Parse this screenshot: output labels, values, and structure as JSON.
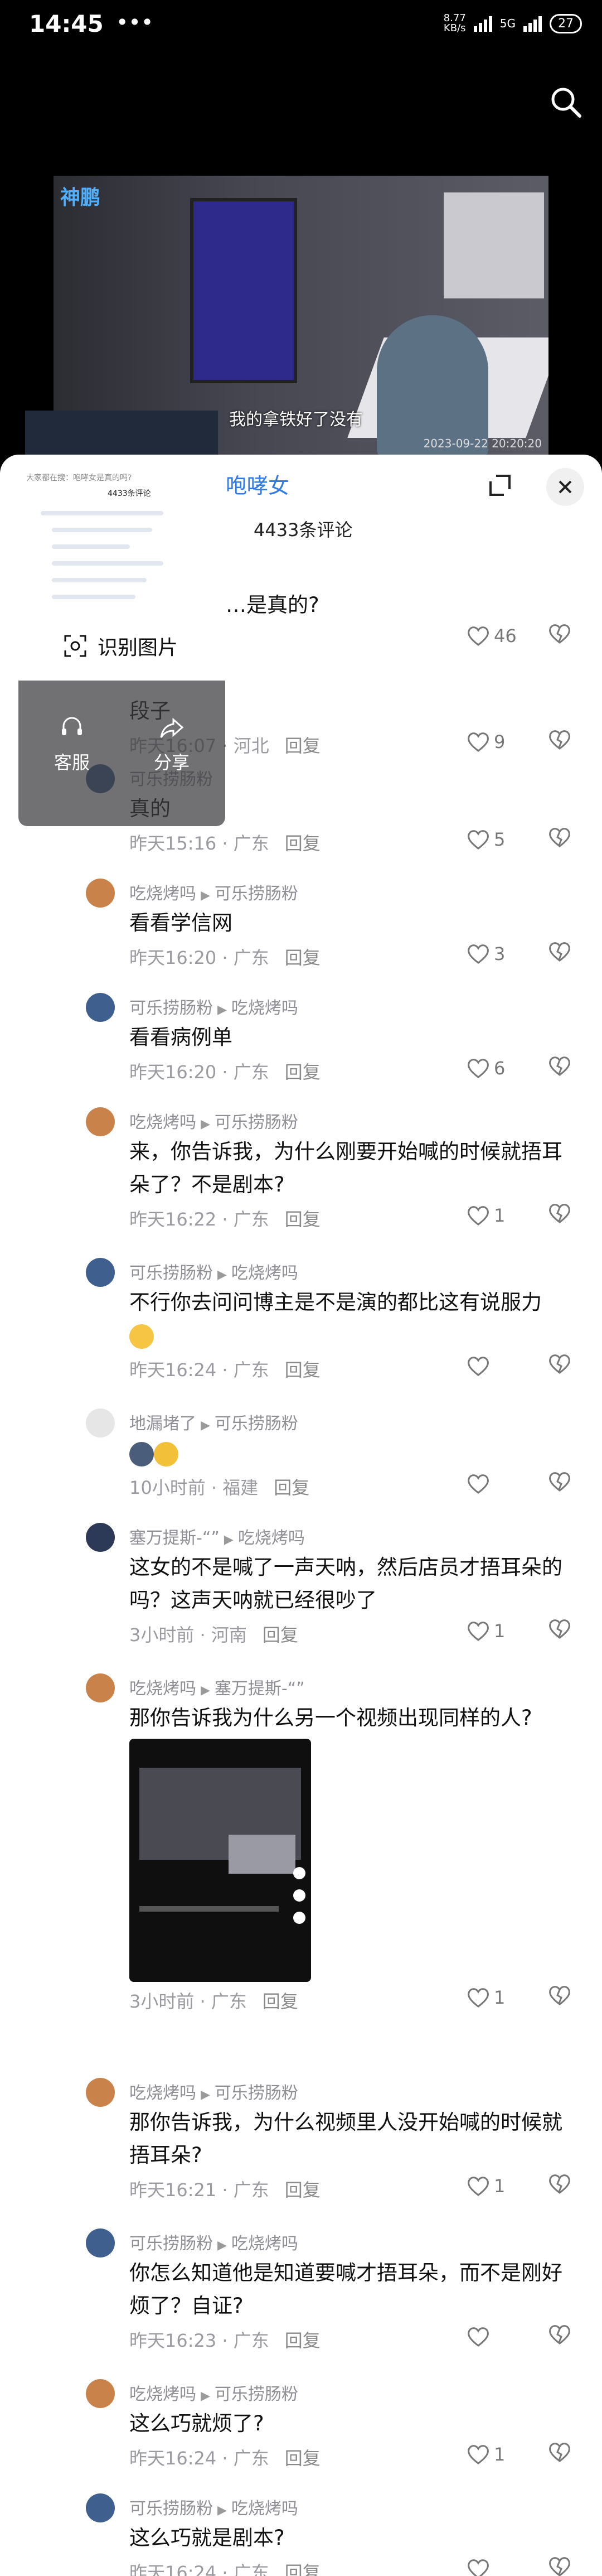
{
  "status_bar": {
    "time": "14:45",
    "dots": "•••",
    "net_speed": "8.77",
    "net_unit": "KB/s",
    "network": "5G",
    "battery": "27"
  },
  "video": {
    "logo": "神鹏",
    "caption": "我的拿铁好了没有",
    "timestamp": "2023-09-22 20:20:20"
  },
  "panel": {
    "title_fragment": "咆哮女",
    "comment_count": "4433条评论"
  },
  "popup": {
    "recognize_label": "识别图片",
    "service_label": "客服",
    "share_label": "分享",
    "preview_header": "4433条评论",
    "preview_title": "大家都在搜：咆哮女是真的吗?"
  },
  "comments": [
    {
      "name": "c1",
      "author": "",
      "reply_to": "",
      "text": "…是真的?",
      "time": "",
      "location": "",
      "reply": "回复",
      "likes": "46",
      "avatar_color": "#d9d9d9"
    },
    {
      "name": "c2",
      "author": "",
      "reply_to": "",
      "text": "段子",
      "time": "昨天16:07",
      "location": "河北",
      "reply": "回复",
      "likes": "9",
      "avatar_color": "#d9d9d9"
    },
    {
      "name": "c3",
      "author": "可乐捞肠粉",
      "reply_to": "",
      "text": "真的",
      "time": "昨天15:16",
      "location": "广东",
      "reply": "回复",
      "likes": "5",
      "avatar_color": "#3f5f8f"
    },
    {
      "name": "c4",
      "author": "吃烧烤吗",
      "reply_to": "可乐捞肠粉",
      "text": "看看学信网",
      "time": "昨天16:20",
      "location": "广东",
      "reply": "回复",
      "likes": "3",
      "avatar_color": "#c9834a"
    },
    {
      "name": "c5",
      "author": "可乐捞肠粉",
      "reply_to": "吃烧烤吗",
      "text": "看看病例单",
      "time": "昨天16:20",
      "location": "广东",
      "reply": "回复",
      "likes": "6",
      "avatar_color": "#3f5f8f"
    },
    {
      "name": "c6",
      "author": "吃烧烤吗",
      "reply_to": "可乐捞肠粉",
      "text": "来，你告诉我，为什么刚要开始喊的时候就捂耳朵了？不是剧本?",
      "time": "昨天16:22",
      "location": "广东",
      "reply": "回复",
      "likes": "1",
      "avatar_color": "#c9834a"
    },
    {
      "name": "c7",
      "author": "可乐捞肠粉",
      "reply_to": "吃烧烤吗",
      "text": "不行你去问问博主是不是演的都比这有说服力",
      "time": "昨天16:24",
      "location": "广东",
      "reply": "回复",
      "likes": "",
      "avatar_color": "#3f5f8f"
    },
    {
      "name": "c8",
      "author": "地漏堵了",
      "reply_to": "可乐捞肠粉",
      "text": "",
      "time": "10小时前",
      "location": "福建",
      "reply": "回复",
      "likes": "",
      "avatar_color": "#e6e6e6"
    },
    {
      "name": "c9",
      "author": "塞万提斯-“”",
      "reply_to": "吃烧烤吗",
      "text": "这女的不是喊了一声天呐，然后店员才捂耳朵的吗？这声天呐就已经很吵了",
      "time": "3小时前",
      "location": "河南",
      "reply": "回复",
      "likes": "1",
      "avatar_color": "#2d3a57"
    },
    {
      "name": "c10",
      "author": "吃烧烤吗",
      "reply_to": "塞万提斯-“”",
      "text": "那你告诉我为什么另一个视频出现同样的人?",
      "time": "3小时前",
      "location": "广东",
      "reply": "回复",
      "likes": "1",
      "avatar_color": "#c9834a"
    },
    {
      "name": "c11",
      "author": "吃烧烤吗",
      "reply_to": "可乐捞肠粉",
      "text": "那你告诉我，为什么视频里人没开始喊的时候就捂耳朵?",
      "time": "昨天16:21",
      "location": "广东",
      "reply": "回复",
      "likes": "1",
      "avatar_color": "#c9834a"
    },
    {
      "name": "c12",
      "author": "可乐捞肠粉",
      "reply_to": "吃烧烤吗",
      "text": "你怎么知道他是知道要喊才捂耳朵，而不是刚好烦了？自证?",
      "time": "昨天16:23",
      "location": "广东",
      "reply": "回复",
      "likes": "",
      "avatar_color": "#3f5f8f"
    },
    {
      "name": "c13",
      "author": "吃烧烤吗",
      "reply_to": "可乐捞肠粉",
      "text": "这么巧就烦了?",
      "time": "昨天16:24",
      "location": "广东",
      "reply": "回复",
      "likes": "1",
      "avatar_color": "#c9834a"
    },
    {
      "name": "c14",
      "author": "可乐捞肠粉",
      "reply_to": "吃烧烤吗",
      "text": "这么巧就是剧本?",
      "time": "昨天16:24",
      "location": "广东",
      "reply": "回复",
      "likes": "",
      "avatar_color": "#3f5f8f"
    }
  ]
}
